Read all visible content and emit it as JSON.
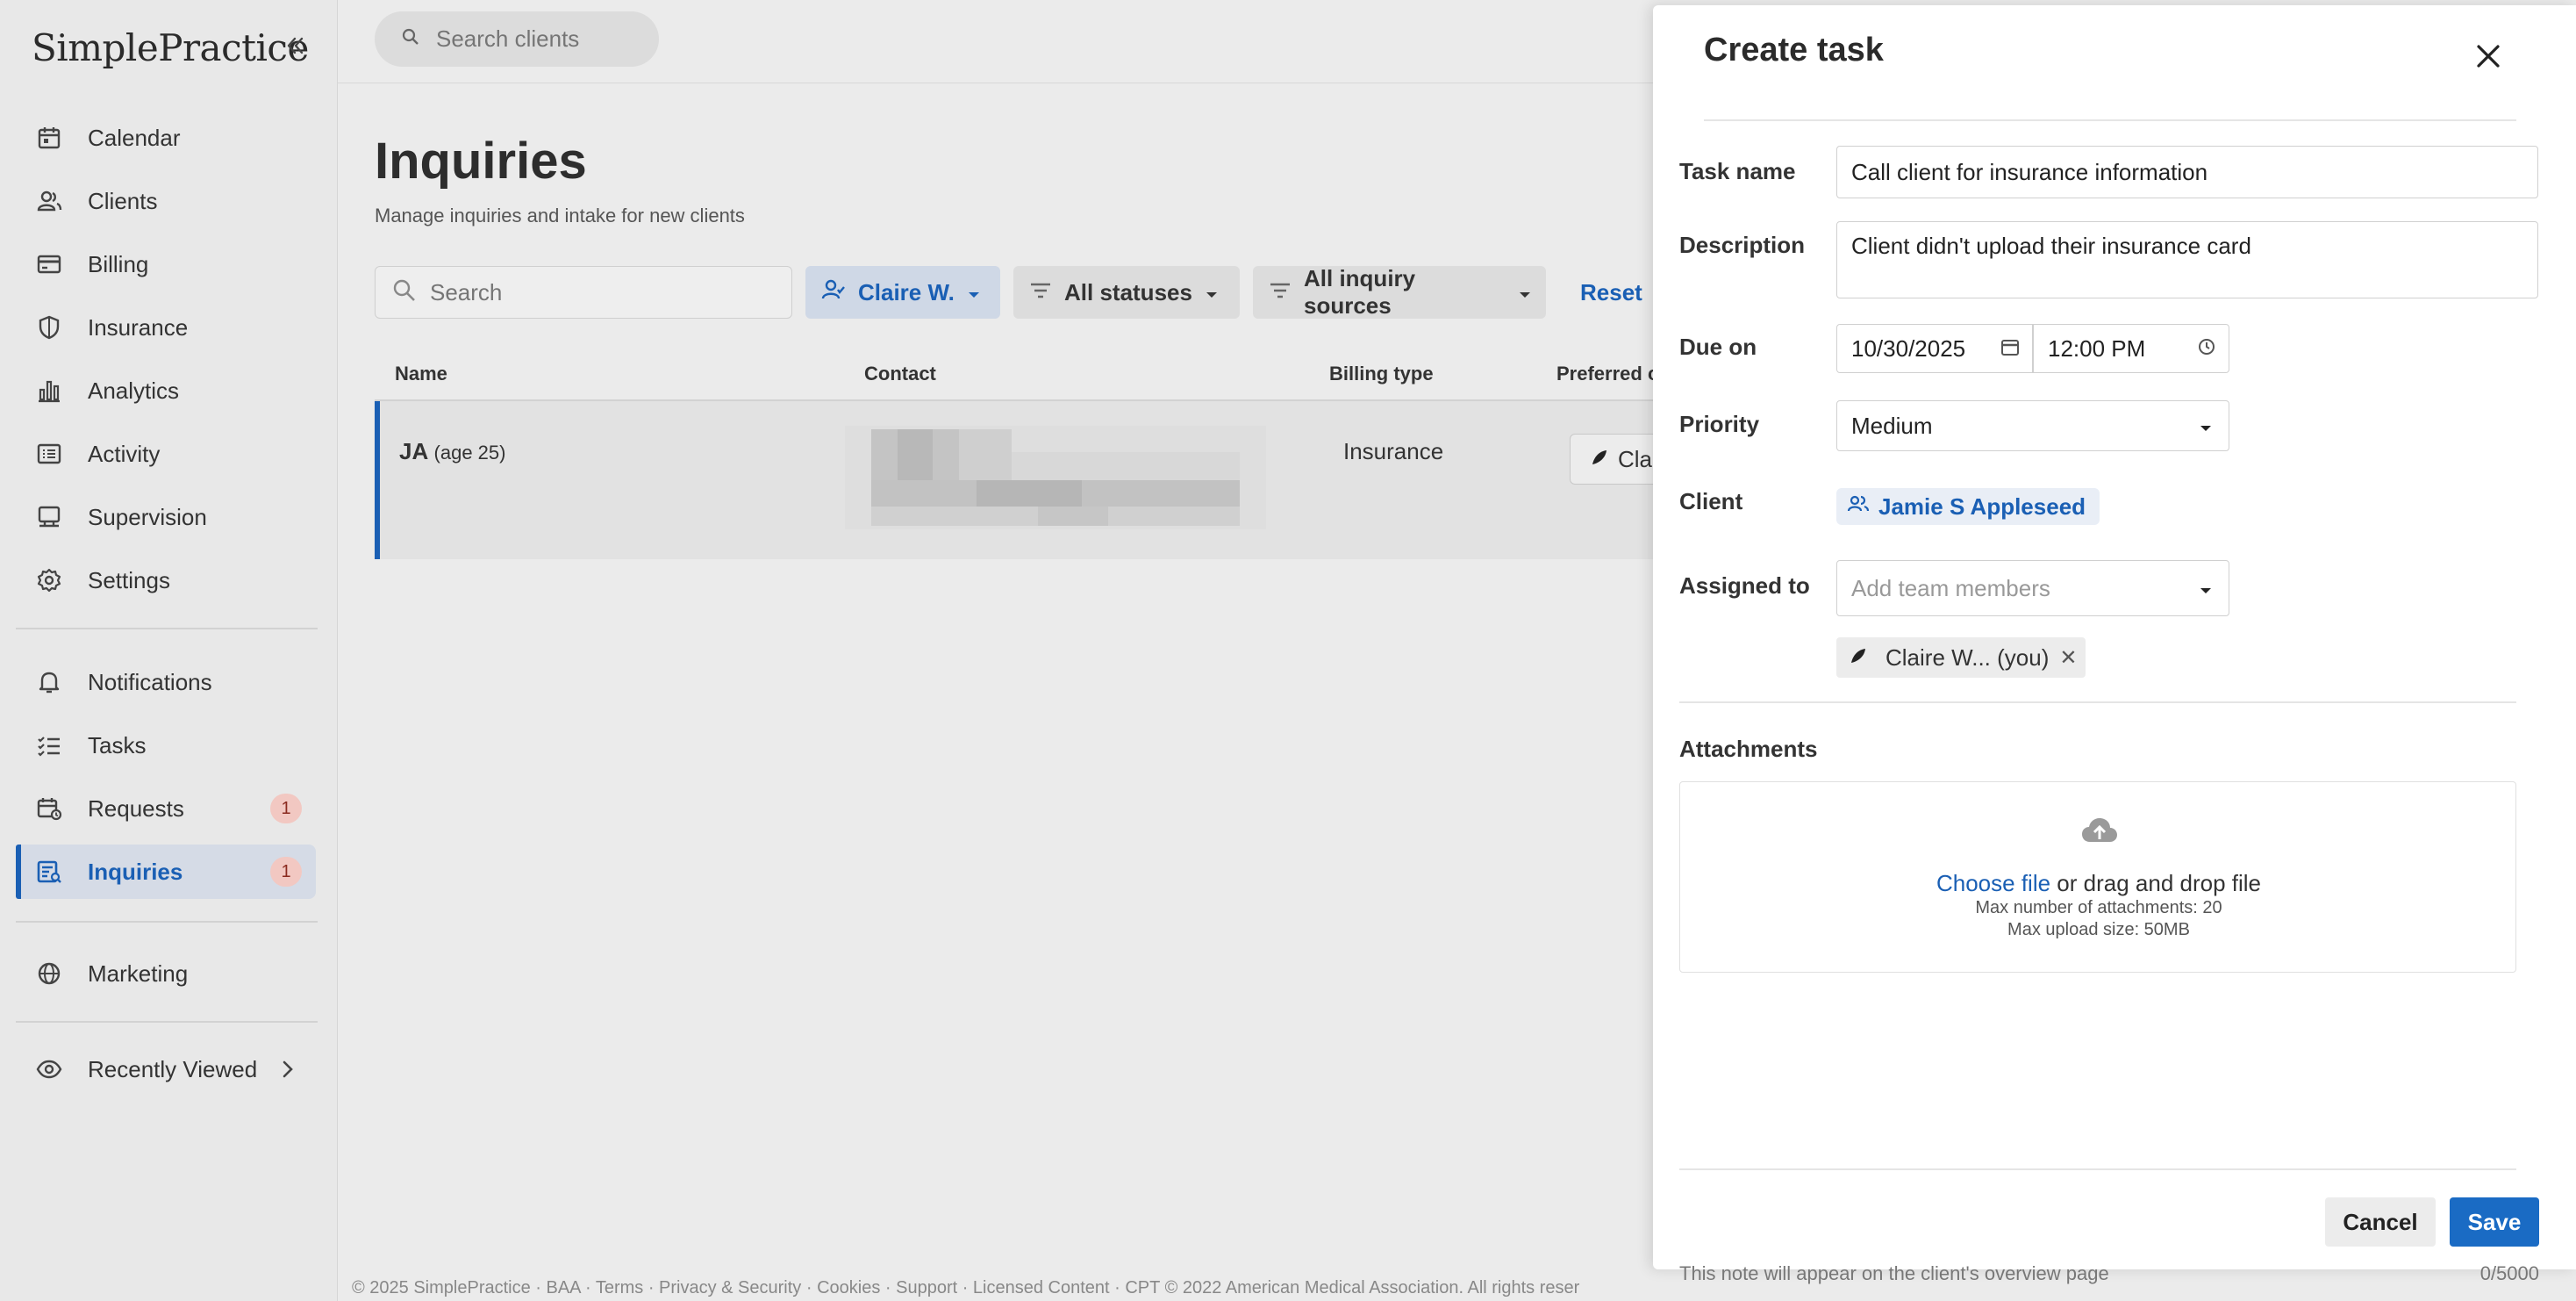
{
  "brand": {
    "logo_text": "SimplePractice"
  },
  "sidebar": {
    "items": [
      {
        "label": "Calendar",
        "icon": "calendar-icon"
      },
      {
        "label": "Clients",
        "icon": "clients-icon"
      },
      {
        "label": "Billing",
        "icon": "billing-icon"
      },
      {
        "label": "Insurance",
        "icon": "shield-icon"
      },
      {
        "label": "Analytics",
        "icon": "analytics-icon"
      },
      {
        "label": "Activity",
        "icon": "activity-icon"
      },
      {
        "label": "Supervision",
        "icon": "supervision-icon"
      },
      {
        "label": "Settings",
        "icon": "gear-icon"
      },
      {
        "label": "Notifications",
        "icon": "bell-icon"
      },
      {
        "label": "Tasks",
        "icon": "tasks-icon"
      },
      {
        "label": "Requests",
        "icon": "requests-icon",
        "badge": "1"
      },
      {
        "label": "Inquiries",
        "icon": "inquiries-icon",
        "badge": "1",
        "active": true
      },
      {
        "label": "Marketing",
        "icon": "globe-icon"
      },
      {
        "label": "Recently Viewed",
        "icon": "eye-icon"
      }
    ]
  },
  "topbar": {
    "search_placeholder": "Search clients"
  },
  "page": {
    "title": "Inquiries",
    "subtitle": "Manage inquiries and intake for new clients"
  },
  "filters": {
    "search_placeholder": "Search",
    "user": "Claire W.",
    "status": "All statuses",
    "source": "All inquiry sources",
    "reset": "Reset"
  },
  "table": {
    "headers": [
      "Name",
      "Contact",
      "Billing type",
      "Preferred c"
    ],
    "rows": [
      {
        "name": "JA",
        "age": "(age 25)",
        "billing": "Insurance",
        "preferred": "Clair"
      }
    ]
  },
  "footer": {
    "text": "© 2025 SimplePractice · BAA · Terms · Privacy & Security · Cookies · Support · Licensed Content · CPT © 2022 American Medical Association. All rights reser"
  },
  "modal": {
    "title": "Create task",
    "task_name_label": "Task name",
    "task_name_value": "Call client for insurance information",
    "description_label": "Description",
    "description_value": "Client didn't upload their insurance card",
    "due_label": "Due on",
    "due_date": "10/30/2025",
    "due_time": "12:00 PM",
    "priority_label": "Priority",
    "priority_value": "Medium",
    "client_label": "Client",
    "client_value": "Jamie S Appleseed",
    "assigned_label": "Assigned to",
    "assigned_placeholder": "Add team members",
    "assigned_member": "Claire W... (you)",
    "attachments_label": "Attachments",
    "choose_file": "Choose file",
    "drag_text": "or drag and drop file",
    "max_count": "Max number of attachments: 20",
    "max_size": "Max upload size: 50MB",
    "cancel": "Cancel",
    "save": "Save",
    "note": "This note will appear on the client's overview page",
    "count": "0/5000"
  },
  "colors": {
    "accent": "#1a5fb4",
    "badge_bg": "#f2c8c2"
  }
}
